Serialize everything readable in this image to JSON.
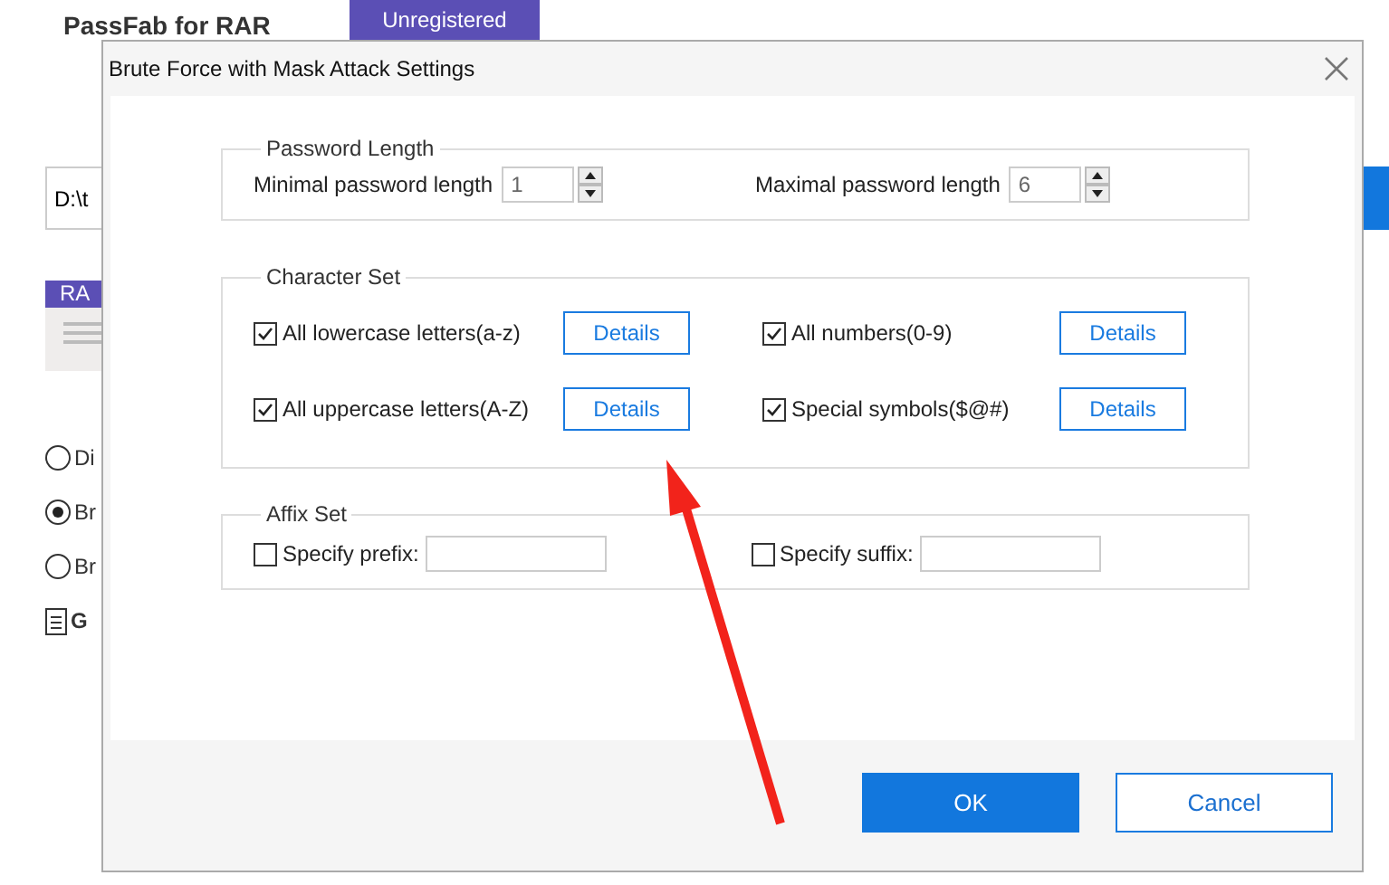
{
  "app": {
    "title": "PassFab for RAR",
    "status_tab": "Unregistered",
    "path_field": "D:\\t",
    "card_label": "RA",
    "attack_options": [
      {
        "label": "Di",
        "selected": false
      },
      {
        "label": "Br",
        "selected": true
      },
      {
        "label": "Br",
        "selected": false
      }
    ],
    "guide_label": "G"
  },
  "dialog": {
    "title": "Brute Force with Mask Attack Settings",
    "password_length": {
      "title": "Password Length",
      "fields": [
        {
          "label": "Minimal password length",
          "value": "1"
        },
        {
          "label": "Maximal password length",
          "value": "6"
        }
      ]
    },
    "character_set": {
      "title": "Character Set",
      "options": [
        {
          "label": "All lowercase letters(a-z)",
          "checked": true,
          "button": "Details"
        },
        {
          "label": "All numbers(0-9)",
          "checked": true,
          "button": "Details"
        },
        {
          "label": "All uppercase letters(A-Z)",
          "checked": true,
          "button": "Details"
        },
        {
          "label": "Special symbols($@#)",
          "checked": true,
          "button": "Details"
        }
      ]
    },
    "affix_set": {
      "title": "Affix Set",
      "options": [
        {
          "label": "Specify prefix:",
          "checked": false
        },
        {
          "label": "Specify suffix:",
          "checked": false
        }
      ]
    },
    "buttons": [
      {
        "label": "OK",
        "kind": "primary"
      },
      {
        "label": "Cancel",
        "kind": "secondary"
      }
    ]
  }
}
